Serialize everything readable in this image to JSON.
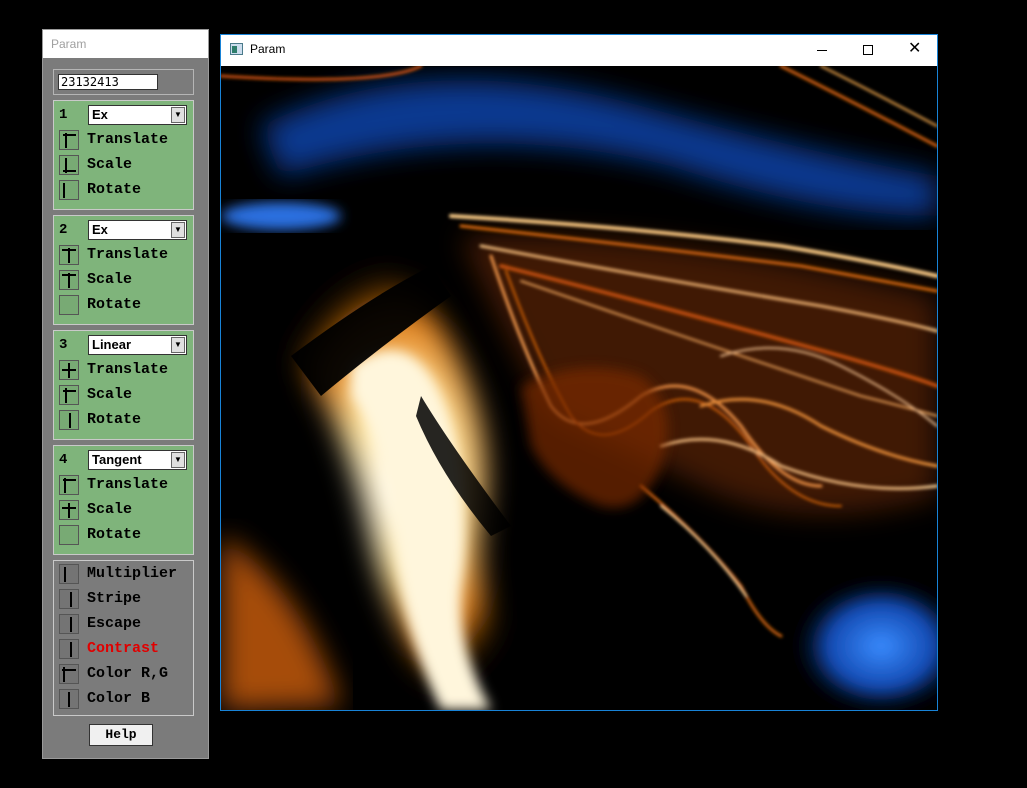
{
  "control_panel": {
    "title": "Param",
    "seed": "23132413",
    "groups": [
      {
        "number": "1",
        "function": "Ex",
        "rows": [
          {
            "label": "Translate"
          },
          {
            "label": "Scale"
          },
          {
            "label": "Rotate"
          }
        ]
      },
      {
        "number": "2",
        "function": "Ex",
        "rows": [
          {
            "label": "Translate"
          },
          {
            "label": "Scale"
          },
          {
            "label": "Rotate"
          }
        ]
      },
      {
        "number": "3",
        "function": "Linear",
        "rows": [
          {
            "label": "Translate"
          },
          {
            "label": "Scale"
          },
          {
            "label": "Rotate"
          }
        ]
      },
      {
        "number": "4",
        "function": "Tangent",
        "rows": [
          {
            "label": "Translate"
          },
          {
            "label": "Scale"
          },
          {
            "label": "Rotate"
          }
        ]
      }
    ],
    "global_params": [
      {
        "label": "Multiplier"
      },
      {
        "label": "Stripe"
      },
      {
        "label": "Escape"
      },
      {
        "label": "Contrast",
        "color": "#e00000"
      },
      {
        "label": "Color R,G"
      },
      {
        "label": "Color B"
      }
    ],
    "help_label": "Help"
  },
  "render_window": {
    "title": "Param",
    "icon": "app-window-icon",
    "controls": [
      "minimize-icon",
      "maximize-icon",
      "close-icon"
    ]
  },
  "colors": {
    "panel_bg": "#7b7b7b",
    "group_bg": "#7fb47b",
    "accent_border": "#1883d7",
    "fractal_orange": "#e07010",
    "fractal_blue": "#1860d0"
  }
}
